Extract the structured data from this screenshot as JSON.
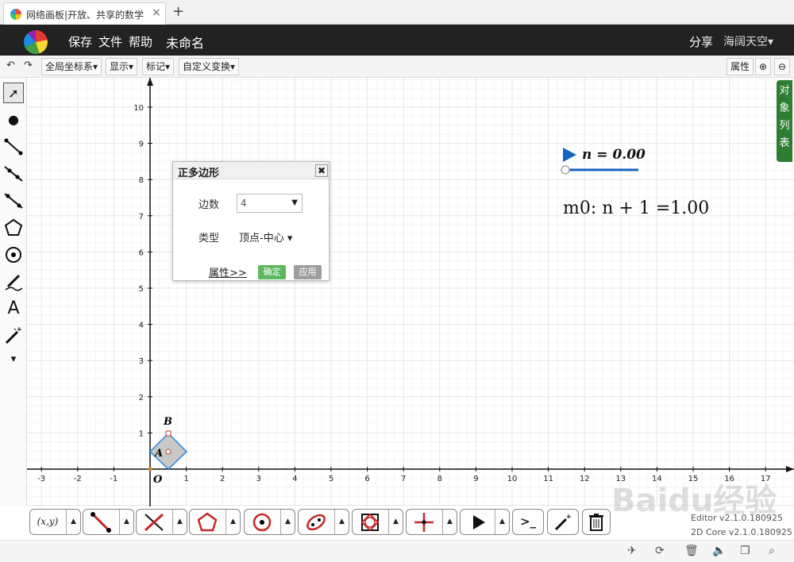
{
  "browser": {
    "tab_title": "网络画板|开放、共享的数学",
    "close_glyph": "×",
    "newtab_glyph": "+"
  },
  "menu": {
    "save": "保存",
    "file": "文件",
    "help": "帮助",
    "doc_name": "未命名",
    "share": "分享",
    "user": "海阔天空▾"
  },
  "toolbar": {
    "undo": "↶",
    "redo": "↷",
    "coord": "全局坐标系▾",
    "display": "显示▾",
    "mark": "标记▾",
    "transform": "自定义变换▾",
    "props": "属性",
    "zoom_in": "⊕",
    "zoom_out": "⊖"
  },
  "left_tools": {
    "select": "➚",
    "point": "●",
    "text": "A",
    "more": "▾"
  },
  "object_list": {
    "label": "对象列表"
  },
  "dialog": {
    "title": "正多边形",
    "close": "✖",
    "sides_label": "边数",
    "sides_value": "4",
    "type_label": "类型",
    "type_value": "顶点-中心 ▾",
    "props_link": "属性>>",
    "ok": "确定",
    "apply": "应用"
  },
  "slider": {
    "label": "n = 0.00",
    "value": 0.0,
    "color": "#1565c0"
  },
  "expression": {
    "text": "m0: n + 1 =1.00"
  },
  "graph": {
    "x_ticks": [
      -3,
      -2,
      -1,
      1,
      2,
      3,
      4,
      5,
      6,
      7,
      8,
      9,
      10,
      11,
      12,
      13,
      14,
      15,
      16,
      17
    ],
    "y_ticks": [
      1,
      2,
      3,
      4,
      5,
      6,
      7,
      8,
      9,
      10
    ],
    "origin_label": "O",
    "point_a": "A",
    "point_b": "B",
    "polygon_fill": "#c8c8c8",
    "polygon_stroke": "#1e88e5"
  },
  "bottom_tools": {
    "coord": "(x,y)",
    "more_glyph": "▲",
    "cli": ">_"
  },
  "version": {
    "editor": "Editor v2.1.0.180925",
    "core": "2D Core v2.1.0.180925"
  },
  "watermark": "Baidu经验",
  "colors": {
    "accent_green": "#2e7d32",
    "menu_bg": "#222222",
    "ok_green": "#5cb85c"
  }
}
